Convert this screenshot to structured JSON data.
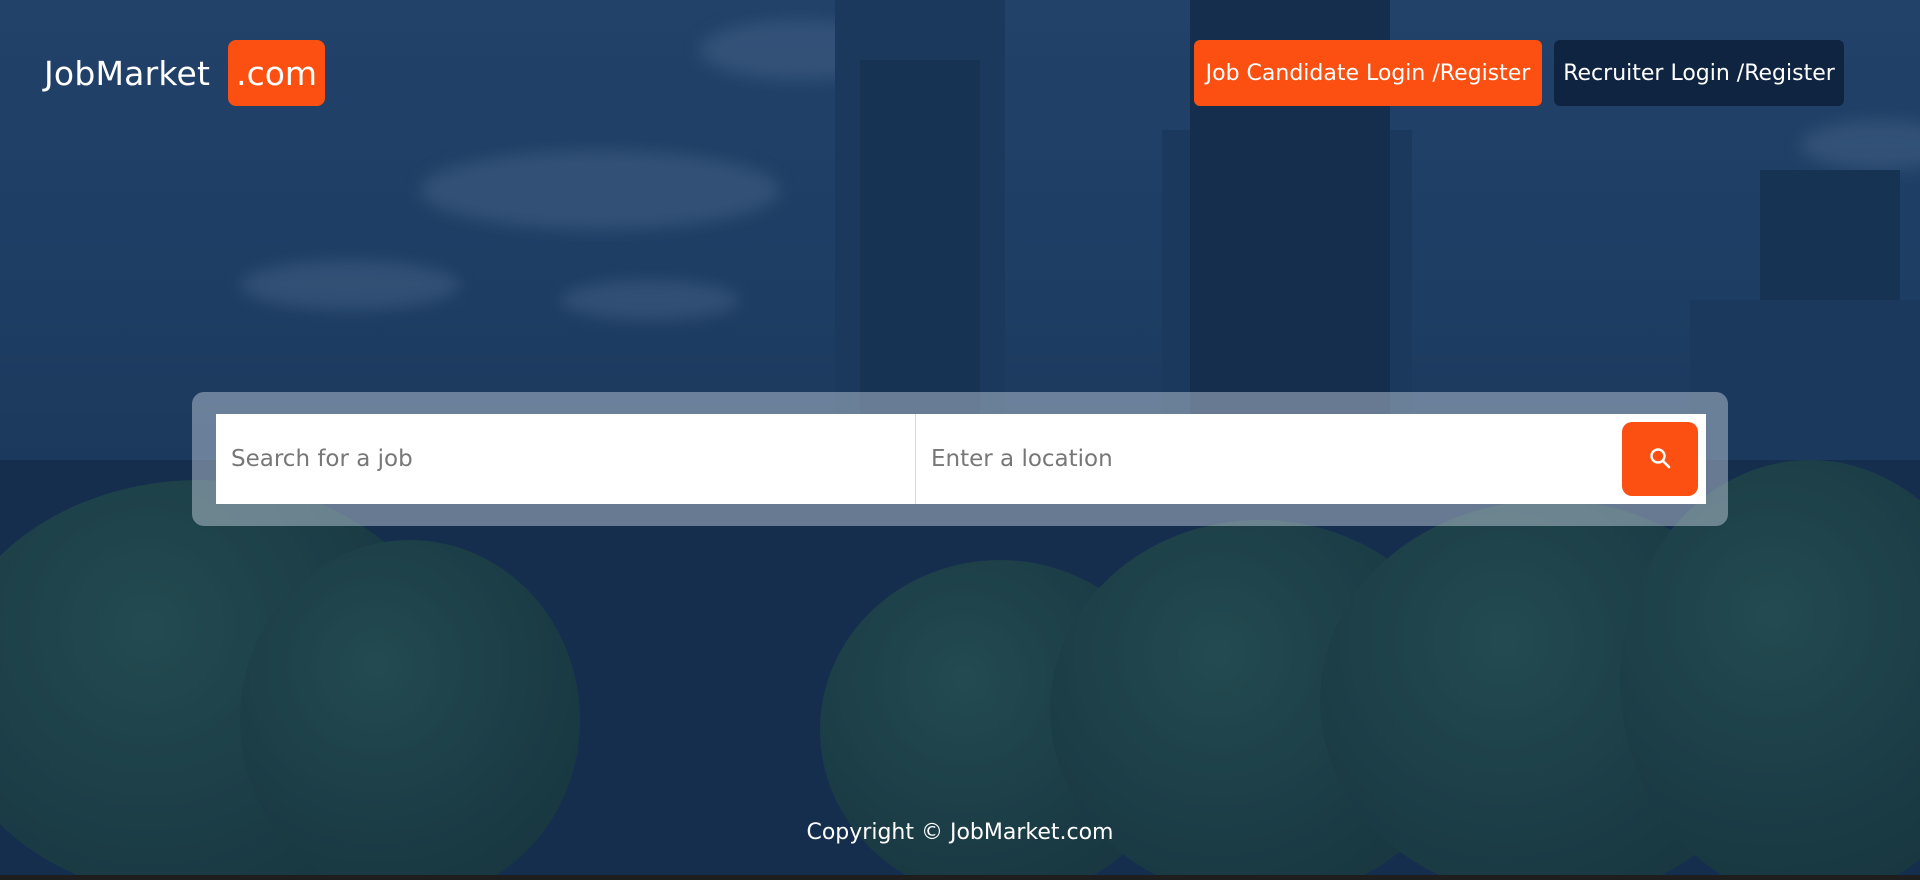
{
  "header": {
    "logo_main": "JobMarket",
    "logo_suffix": ".com",
    "candidate_button": "Job Candidate Login /Register",
    "recruiter_button": "Recruiter Login /Register"
  },
  "search": {
    "job_placeholder": "Search for a job",
    "job_value": "",
    "location_placeholder": "Enter a location",
    "location_value": "",
    "button_icon": "search-icon"
  },
  "footer": {
    "copyright": "Copyright © JobMarket.com"
  },
  "colors": {
    "accent": "#fb5012",
    "dark_button": "#0f2440",
    "background_tint": "#1c3a5e"
  }
}
